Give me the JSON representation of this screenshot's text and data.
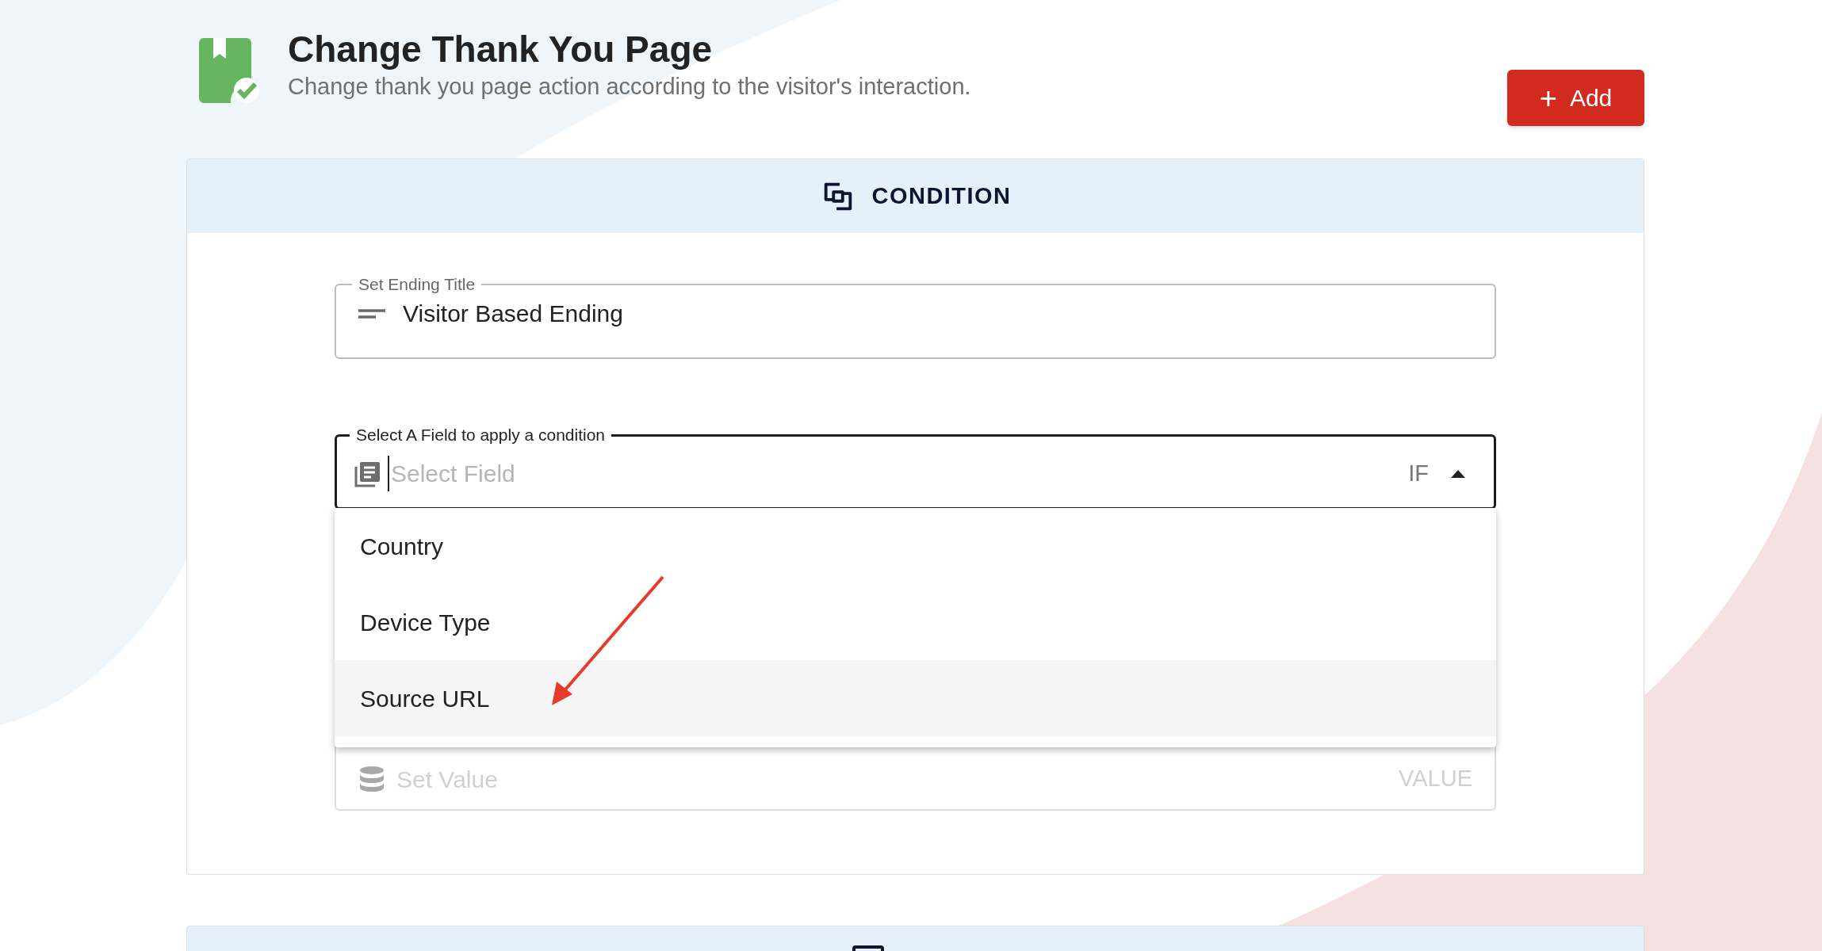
{
  "header": {
    "title": "Change Thank You Page",
    "subtitle": "Change thank you page action according to the visitor's interaction.",
    "add_button": "Add",
    "add_icon": "+"
  },
  "condition_card": {
    "title": "CONDITION",
    "title_field": {
      "label": "Set Ending Title",
      "value": "Visitor Based Ending"
    },
    "select_field": {
      "label": "Select A Field to apply a condition",
      "placeholder": "Select Field",
      "suffix": "IF",
      "expanded": true
    },
    "dropdown_items": [
      {
        "label": "Country",
        "selected": false
      },
      {
        "label": "Device Type",
        "selected": false
      },
      {
        "label": "Source URL",
        "selected": true
      }
    ],
    "value_field": {
      "placeholder": "Set Value",
      "suffix": "VALUE"
    }
  }
}
